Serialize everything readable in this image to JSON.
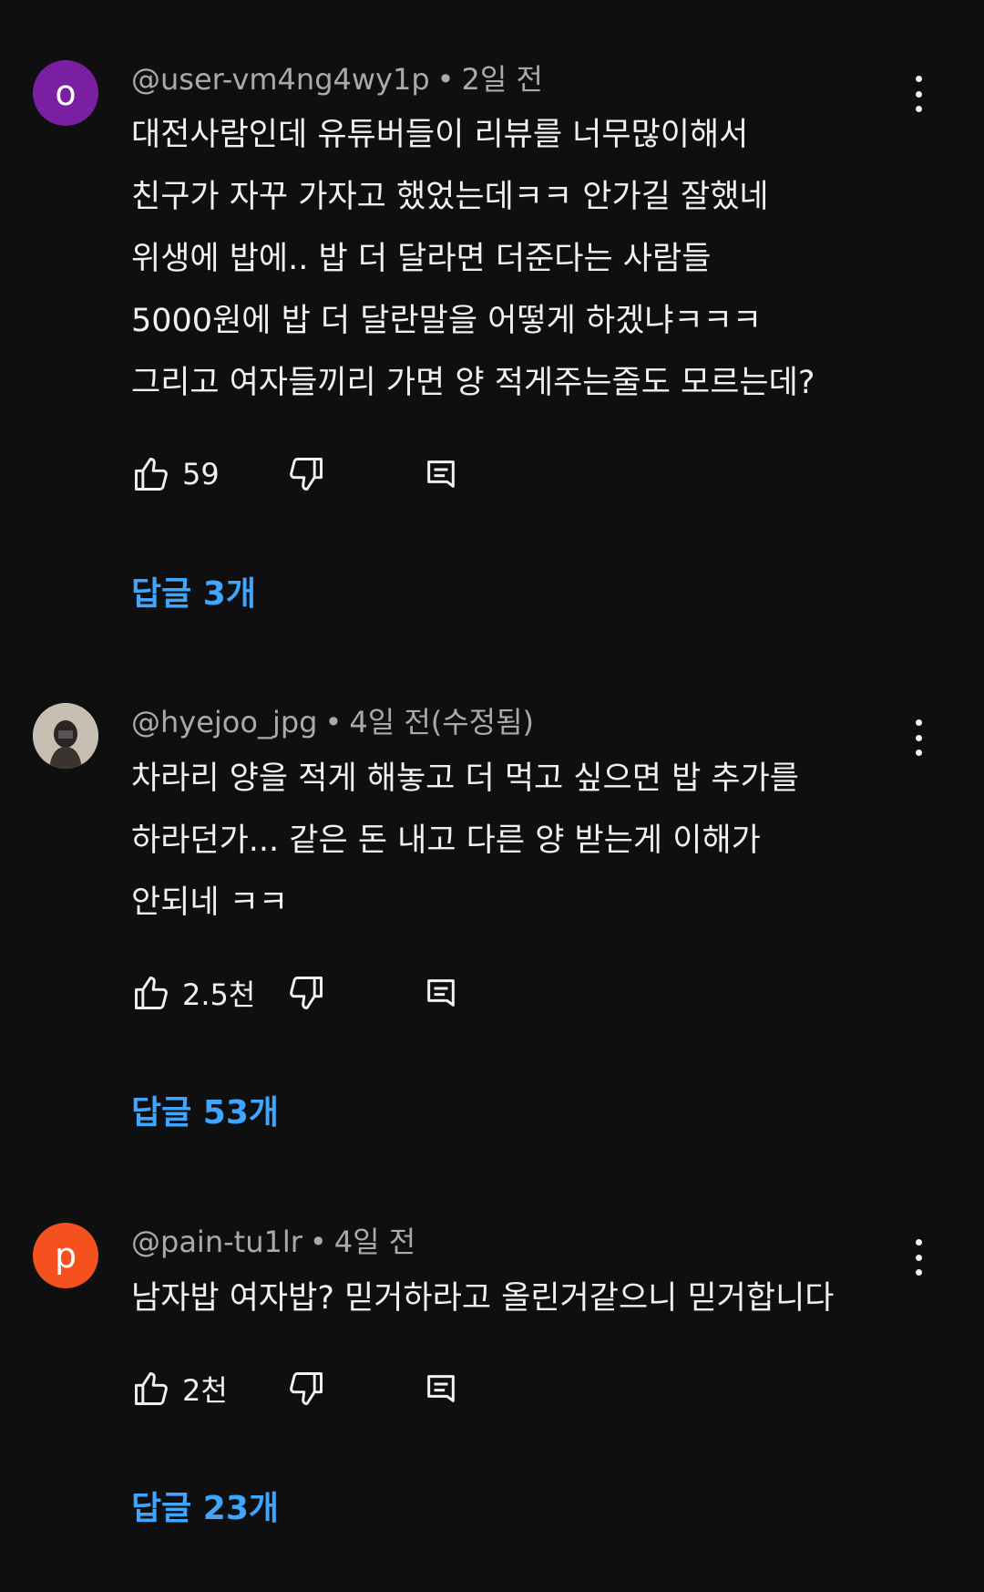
{
  "comments": [
    {
      "avatar_letter": "o",
      "avatar_color": "#7b1fa2",
      "handle": "@user-vm4ng4wy1p",
      "time": "2일 전",
      "text": "대전사람인데 유튜버들이 리뷰를 너무많이해서\n친구가 자꾸 가자고 했었는데ㅋㅋ 안가길 잘했네\n위생에 밥에.. 밥 더 달라면 더준다는 사람들\n5000원에 밥 더 달란말을 어떻게 하겠냐ㅋㅋㅋ\n그리고 여자들끼리 가면 양 적게주는줄도 모르는데?",
      "likes": "59",
      "replies": "답글 3개"
    },
    {
      "avatar_letter": "",
      "avatar_color": "#b9b0a4",
      "handle": "@hyejoo_jpg",
      "time": "4일 전(수정됨)",
      "text": "차라리 양을 적게 해놓고 더 먹고 싶으면 밥 추가를\n하라던가... 같은 돈 내고 다른 양 받는게 이해가\n안되네 ㅋㅋ",
      "likes": "2.5천",
      "replies": "답글 53개"
    },
    {
      "avatar_letter": "p",
      "avatar_color": "#f4511e",
      "handle": "@pain-tu1lr",
      "time": "4일 전",
      "text": "남자밥 여자밥? 믿거하라고 올린거같으니 믿거합니다",
      "likes": "2천",
      "replies": "답글 23개"
    }
  ],
  "icons": {
    "like": "thumbs-up-icon",
    "dislike": "thumbs-down-icon",
    "reply": "reply-comment-icon",
    "more": "more-vertical-icon"
  },
  "colors": {
    "background": "#0f0f0f",
    "text": "#f1f1f1",
    "meta": "#aaaaaa",
    "link": "#3ea6ff"
  }
}
